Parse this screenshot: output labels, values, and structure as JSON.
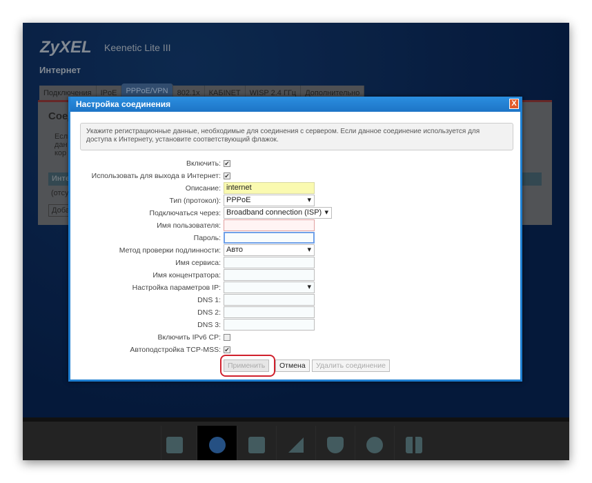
{
  "header": {
    "logo": "ZyXEL",
    "model": "Keenetic Lite III",
    "section": "Интернет"
  },
  "tabs": [
    "Подключения",
    "IPoE",
    "PPPoE/VPN",
    "802.1x",
    "КАБINET",
    "WISP 2.4 ГГц",
    "Дополнительно"
  ],
  "background": {
    "heading": "Соед",
    "text1": "Есл",
    "text2": "дан",
    "text3": "кор",
    "table_header": "Инте",
    "table_cell": "(отсу",
    "add_button": "Доба"
  },
  "dialog": {
    "title": "Настройка соединения",
    "close": "X",
    "info": "Укажите регистрационные данные, необходимые для соединения с сервером. Если данное соединение используется для доступа к Интернету, установите соответствующий флажок.",
    "fields": {
      "enable": {
        "label": "Включить:",
        "checked": "✔"
      },
      "use_internet": {
        "label": "Использовать для выхода в Интернет:",
        "checked": "✔"
      },
      "description": {
        "label": "Описание:",
        "value": "internet"
      },
      "type": {
        "label": "Тип (протокол):",
        "value": "PPPoE"
      },
      "via": {
        "label": "Подключаться через:",
        "value": "Broadband connection (ISP)"
      },
      "username": {
        "label": "Имя пользователя:",
        "value": ""
      },
      "password": {
        "label": "Пароль:",
        "value": ""
      },
      "auth": {
        "label": "Метод проверки подлинности:",
        "value": "Авто"
      },
      "service": {
        "label": "Имя сервиса:",
        "value": ""
      },
      "concentrator": {
        "label": "Имя концентратора:",
        "value": ""
      },
      "ip": {
        "label": "Настройка параметров IP:",
        "value": ""
      },
      "dns1": {
        "label": "DNS 1:",
        "value": ""
      },
      "dns2": {
        "label": "DNS 2:",
        "value": ""
      },
      "dns3": {
        "label": "DNS 3:",
        "value": ""
      },
      "ipv6": {
        "label": "Включить IPv6 CP:",
        "checked": ""
      },
      "tcpmss": {
        "label": "Автоподстройка TCP-MSS:",
        "checked": "✔"
      }
    },
    "buttons": {
      "apply": "Применить",
      "cancel": "Отмена",
      "delete": "Удалить соединение"
    }
  },
  "bottom_nav": [
    "monitor-icon",
    "internet-globe-icon",
    "home-network-icon",
    "wifi-signal-icon",
    "security-shield-icon",
    "system-gear-icon",
    "apps-grid-icon"
  ]
}
